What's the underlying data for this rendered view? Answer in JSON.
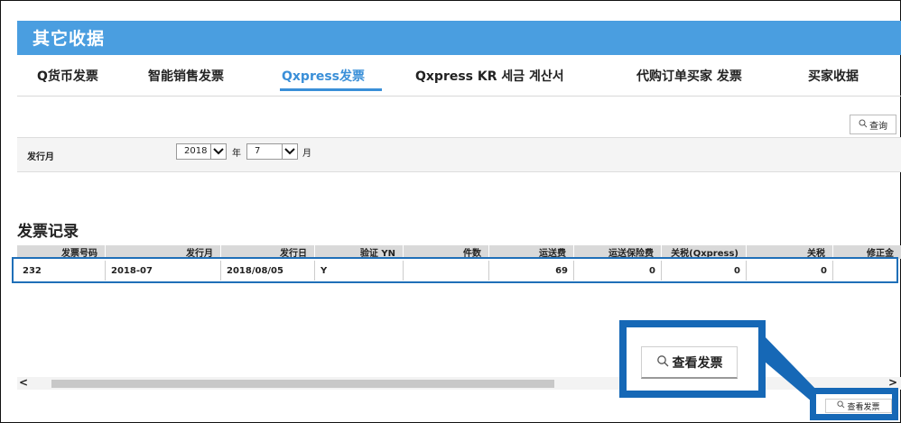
{
  "header": {
    "title": "其它收据"
  },
  "tabs": [
    {
      "label": "Q货币发票"
    },
    {
      "label": "智能销售发票"
    },
    {
      "label": "Qxpress发票",
      "active": true
    },
    {
      "label": "Qxpress KR 세금 계산서"
    },
    {
      "label": "代购订单买家 发票"
    },
    {
      "label": "买家收据"
    }
  ],
  "query_button": {
    "label": "查询",
    "icon": "search-icon"
  },
  "filter": {
    "label": "发行月",
    "year_value": "2018",
    "year_unit": "年",
    "month_value": "7",
    "month_unit": "月"
  },
  "section": {
    "title": "发票记录"
  },
  "table": {
    "headers": [
      "发票号码",
      "发行月",
      "发行日",
      "验证 YN",
      "件数",
      "运送费",
      "运送保险费",
      "关税(Qxpress)",
      "关税",
      "修正金"
    ],
    "row": [
      "232",
      "2018-07",
      "2018/08/05",
      "Y",
      "",
      "69",
      "0",
      "0",
      "0",
      ""
    ]
  },
  "view_invoice": {
    "label": "查看发票",
    "icon": "search-icon"
  },
  "colors": {
    "header_bg": "#4a9ee0",
    "accent": "#3a8fd8",
    "callout": "#1668b6"
  }
}
